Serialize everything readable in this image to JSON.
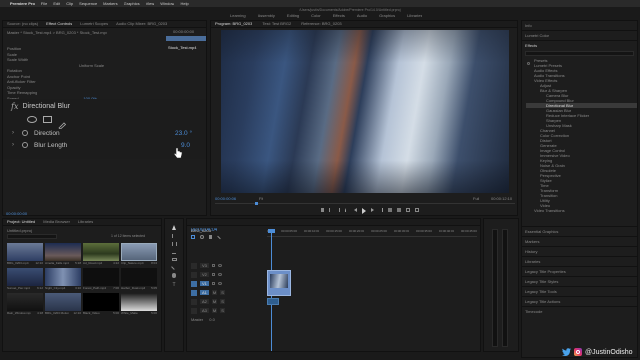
{
  "menubar": {
    "app_name": "Premiere Pro",
    "items": [
      "File",
      "Edit",
      "Clip",
      "Sequence",
      "Markers",
      "Graphics",
      "View",
      "Window",
      "Help"
    ],
    "path": "/Users/justin/Documents/Adobe/Premiere Pro/14.0/Untitled.prproj"
  },
  "workspaces": [
    "Learning",
    "Assembly",
    "Editing",
    "Color",
    "Effects",
    "Audio",
    "Graphics",
    "Libraries"
  ],
  "effect_controls": {
    "tabs": [
      "Source: (no clips)",
      "Effect Controls",
      "Lumetri Scopes",
      "Audio Clip Mixer: BRG_0203"
    ],
    "clip_label": "Master * Stock_Test.mp4 > BRG_0203 * Stock_Test.mp4",
    "clip_name": "Stock_Test.mp4",
    "rows": [
      {
        "label": "Position",
        "value": ""
      },
      {
        "label": "Scale",
        "value": ""
      },
      {
        "label": "Scale Width",
        "value": ""
      },
      {
        "label": "",
        "value": "Uniform Scale"
      },
      {
        "label": "Rotation",
        "value": ""
      },
      {
        "label": "Anchor Point",
        "value": ""
      },
      {
        "label": "Anti-flicker Filter",
        "value": ""
      },
      {
        "label": "Opacity",
        "value": ""
      },
      {
        "label": "Time Remapping",
        "value": ""
      },
      {
        "label": "Speed",
        "value": "100.0%"
      }
    ],
    "timecode": "00:00:00:00",
    "fx_name": "Directional Blur",
    "direction_label": "Direction",
    "direction_value": "23.0 °",
    "blur_length_label": "Blur Length",
    "blur_length_value": "9.0"
  },
  "program_monitor": {
    "tabs": [
      "Program: BRG_0203",
      "Test: Test BRG2",
      "Reference: BRG_0203"
    ],
    "timecode_left": "00:00:00:06",
    "fit": "Fit",
    "quality": "Full",
    "timecode_right": "00:00:12:10"
  },
  "effects_panel": {
    "top_items": [
      "Info",
      "Lumetri Color",
      "Effects"
    ],
    "search_placeholder": "",
    "tree": [
      "Presets",
      "Lumetri Presets",
      "Audio Effects",
      "Audio Transitions",
      "Video Effects",
      "Adjust",
      "Blur & Sharpen",
      "Camera Blur",
      "Compound Blur",
      "Directional Blur",
      "Gaussian Blur",
      "Reduce Interlace Flicker",
      "Sharpen",
      "Unsharp Mask",
      "Channel",
      "Color Correction",
      "Distort",
      "Generate",
      "Image Control",
      "Immersive Video",
      "Keying",
      "Noise & Grain",
      "Obsolete",
      "Perspective",
      "Stylize",
      "Time",
      "Transform",
      "Transition",
      "Utility",
      "Video",
      "Video Transitions"
    ],
    "bottom_items": [
      "Essential Graphics",
      "Markers",
      "History",
      "Libraries",
      "Legacy Title Properties",
      "Legacy Title Styles",
      "Legacy Title Tools",
      "Legacy Title Actions",
      "Timecode"
    ]
  },
  "project_panel": {
    "tabs": [
      "Project: Untitled",
      "Media Browser",
      "Libraries"
    ],
    "project_file": "Untitled.prproj",
    "item_count": "1 of 12 items selected",
    "thumbnails": [
      {
        "name": "BRG_0203.mp4",
        "dur": "12:10"
      },
      {
        "name": "Amelia_Falls.mp4",
        "dur": "5:18"
      },
      {
        "name": "Ad_Road.mp4",
        "dur": "4:22"
      },
      {
        "name": "Clip_Nature.mp4",
        "dur": "8:04"
      },
      {
        "name": "Sunset_Pier.mp4",
        "dur": "6:12"
      },
      {
        "name": "Night_City.mp4",
        "dur": "3:10"
      },
      {
        "name": "Forest_Path.mp4",
        "dur": "7:00"
      },
      {
        "name": "Harbor_Dusk.mp4",
        "dur": "5:05"
      },
      {
        "name": "Rain_Window.mp4",
        "dur": "4:18"
      },
      {
        "name": "BRG_0203 Motion.mp4",
        "dur": "12:10"
      },
      {
        "name": "Black_Video",
        "dur": "5:00"
      },
      {
        "name": "White_Matte",
        "dur": "5:00"
      }
    ]
  },
  "timeline": {
    "tab": "BRG_0203",
    "timecode": "00:00:04:04",
    "ruler": [
      "00:00",
      "00:00:05:00",
      "00:00:10:00",
      "00:00:15:00",
      "00:00:20:00",
      "00:00:25:00",
      "00:00:30:00",
      "00:00:35:00",
      "00:00:40:00",
      "00:00:45:00"
    ],
    "tracks": [
      "V3",
      "V2",
      "V1",
      "A1",
      "A2",
      "A3",
      "Master"
    ],
    "master_value": "0.0"
  },
  "watermark": {
    "handle": "@JustinOdisho"
  },
  "colors": {
    "accent": "#4c8cd6",
    "clip_video": "#6c8fc8",
    "clip_audio": "#2f5e8f"
  }
}
